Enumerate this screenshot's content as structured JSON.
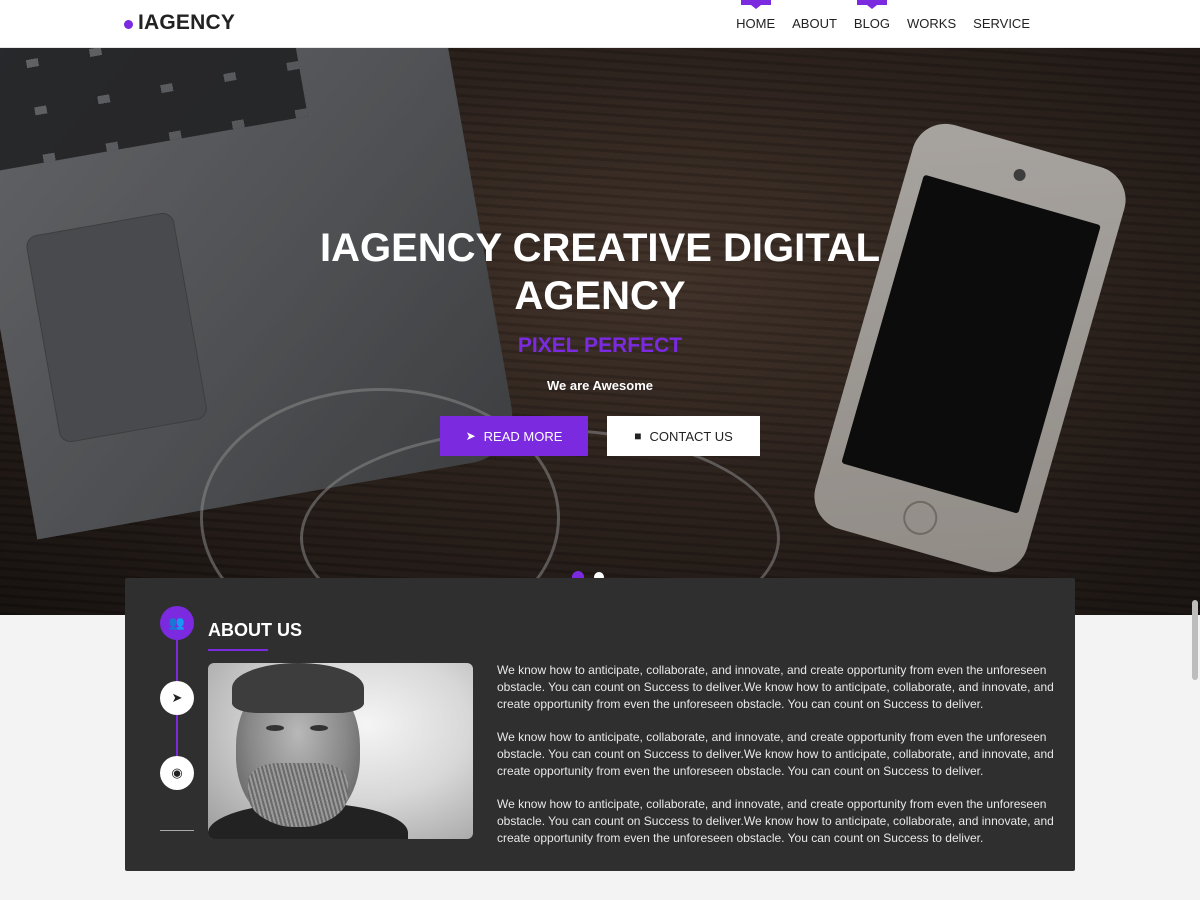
{
  "brand": {
    "logo_text": "IAGENCY",
    "accent_color": "#7b2ae0"
  },
  "nav": {
    "items": [
      {
        "label": "HOME",
        "active": true
      },
      {
        "label": "ABOUT",
        "active": false
      },
      {
        "label": "BLOG",
        "active": true
      },
      {
        "label": "WORKS",
        "active": false
      },
      {
        "label": "SERVICE",
        "active": false
      }
    ]
  },
  "hero": {
    "title": "IAGENCY CREATIVE DIGITAL AGENCY",
    "subtitle": "PIXEL PERFECT",
    "tagline": "We are Awesome",
    "read_more_label": "READ MORE",
    "read_more_icon": "rocket-icon",
    "contact_label": "CONTACT US",
    "contact_icon": "briefcase-icon",
    "slide_count": 2,
    "active_slide": 1
  },
  "about": {
    "title": "ABOUT US",
    "timeline_icons": [
      "users-icon",
      "rocket-icon",
      "eye-icon"
    ],
    "paragraphs": [
      "We know how to anticipate, collaborate, and innovate, and create opportunity from even the unforeseen obstacle. You can count on Success to deliver.We know how to anticipate, collaborate, and innovate, and create opportunity from even the unforeseen obstacle. You can count on Success to deliver.",
      "We know how to anticipate, collaborate, and innovate, and create opportunity from even the unforeseen obstacle. You can count on Success to deliver.We know how to anticipate, collaborate, and innovate, and create opportunity from even the unforeseen obstacle. You can count on Success to deliver.",
      "We know how to anticipate, collaborate, and innovate, and create opportunity from even the unforeseen obstacle. You can count on Success to deliver.We know how to anticipate, collaborate, and innovate, and create opportunity from even the unforeseen obstacle. You can count on Success to deliver."
    ]
  }
}
